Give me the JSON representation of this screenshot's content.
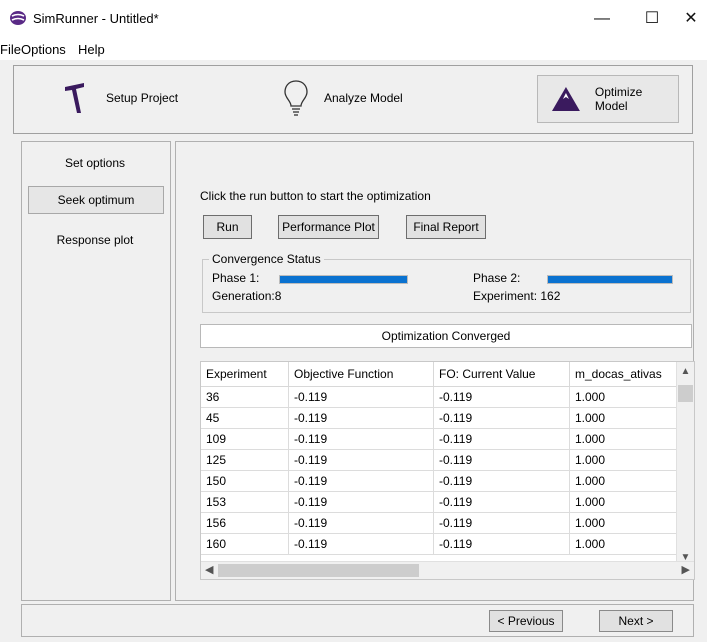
{
  "window": {
    "title": "SimRunner - Untitled*",
    "minimize": "—",
    "maximize": "☐",
    "close": "✕"
  },
  "menu": {
    "items": [
      "File",
      "Options",
      "Help"
    ]
  },
  "top_tabs": {
    "setup": "Setup Project",
    "analyze": "Analyze Model",
    "optimize": "Optimize Model"
  },
  "left_nav": {
    "set_options": "Set options",
    "seek_optimum": "Seek optimum",
    "response_plot": "Response plot"
  },
  "main": {
    "instruction": "Click the run button to start the optimization",
    "buttons": {
      "run": "Run",
      "performance_plot": "Performance Plot",
      "final_report": "Final Report"
    },
    "convergence": {
      "title": "Convergence Status",
      "phase1_label": "Phase 1:",
      "phase1_progress": 1.0,
      "generation": "Generation:8",
      "phase2_label": "Phase 2:",
      "phase2_progress": 1.0,
      "experiment": "Experiment: 162"
    },
    "status": "Optimization Converged",
    "table": {
      "columns": [
        "Experiment",
        "Objective Function",
        "FO: Current Value",
        "m_docas_ativas"
      ],
      "rows": [
        [
          "36",
          "-0.119",
          "-0.119",
          "1.000"
        ],
        [
          "45",
          "-0.119",
          "-0.119",
          "1.000"
        ],
        [
          "109",
          "-0.119",
          "-0.119",
          "1.000"
        ],
        [
          "125",
          "-0.119",
          "-0.119",
          "1.000"
        ],
        [
          "150",
          "-0.119",
          "-0.119",
          "1.000"
        ],
        [
          "153",
          "-0.119",
          "-0.119",
          "1.000"
        ],
        [
          "156",
          "-0.119",
          "-0.119",
          "1.000"
        ],
        [
          "160",
          "-0.119",
          "-0.119",
          "1.000"
        ]
      ]
    }
  },
  "footer": {
    "previous": "< Previous",
    "next": "Next >"
  },
  "colors": {
    "progress": "#0a72d0",
    "brand_icon": "#5a2a86"
  }
}
